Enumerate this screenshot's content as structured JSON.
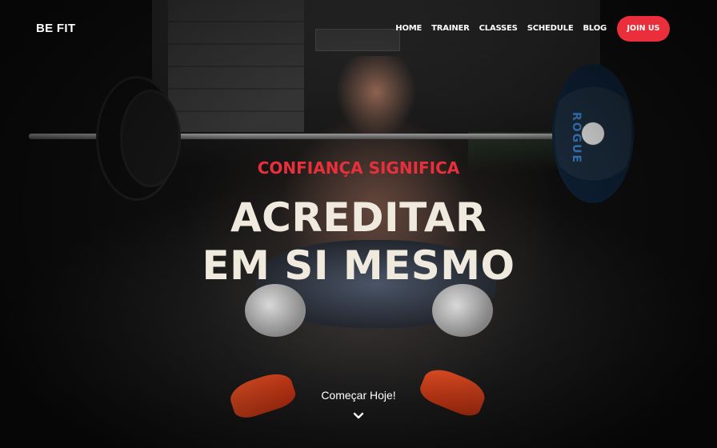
{
  "brand": "BE FIT",
  "nav": {
    "items": [
      {
        "label": "HOME"
      },
      {
        "label": "TRAINER"
      },
      {
        "label": "CLASSES"
      },
      {
        "label": "SCHEDULE"
      },
      {
        "label": "BLOG"
      }
    ],
    "join_label": "JOIN US"
  },
  "hero": {
    "kicker": "CONFIANÇA SIGNIFICA",
    "headline_line1": "ACREDITAR",
    "headline_line2": "EM SI MESMO",
    "cta_label": "Começar Hoje!",
    "background_image": "athlete-barbell-squat-photo"
  },
  "colors": {
    "accent": "#ea2e3b",
    "headline": "#efe9de",
    "background": "#0b0b0b"
  },
  "icons": {
    "scroll": "chevron-down-icon"
  }
}
